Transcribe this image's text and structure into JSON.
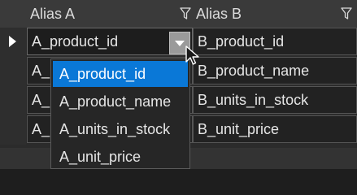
{
  "grid": {
    "columns": [
      {
        "label": "Alias A",
        "filter_icon": "filter-icon"
      },
      {
        "label": "Alias B",
        "filter_icon": "filter-icon"
      }
    ],
    "rows": [
      {
        "alias_a": "A_product_id",
        "alias_b": "B_product_id"
      },
      {
        "alias_a": "A_product_name",
        "alias_b": "B_product_name"
      },
      {
        "alias_a": "A_units_in_stock",
        "alias_b": "B_units_in_stock"
      },
      {
        "alias_a": "A_unit_price",
        "alias_b": "B_unit_price"
      }
    ],
    "row_a_visible": [
      "A_product_id",
      "A_",
      "A_",
      "A_"
    ]
  },
  "dropdown": {
    "selected_value": "A_product_id",
    "options": [
      "A_product_id",
      "A_product_name",
      "A_units_in_stock",
      "A_unit_price"
    ]
  },
  "colors": {
    "selection": "#0a78d7",
    "header_bg": "#3a3a3a",
    "grid_bg": "#222222"
  }
}
